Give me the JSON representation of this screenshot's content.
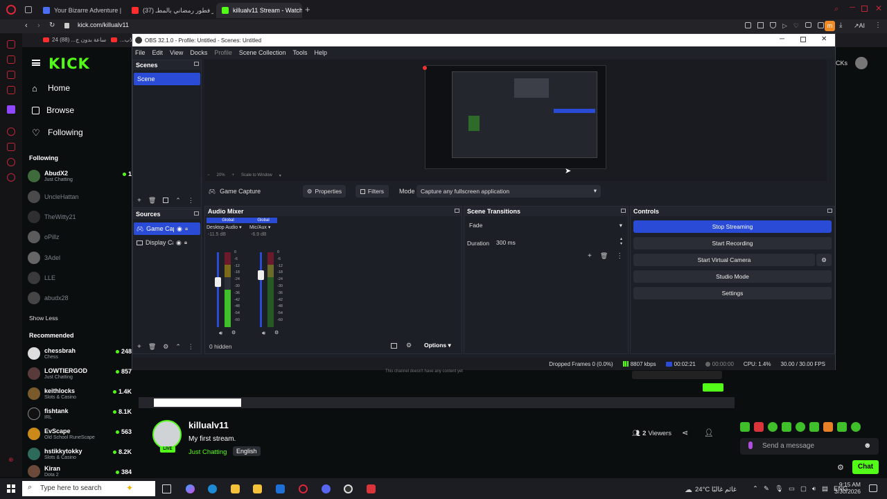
{
  "browser": {
    "tabs": [
      {
        "label": "Your Bizarre Adventure | P",
        "color": "#4c6ef5"
      },
      {
        "label": "افطر فطور رمضاني بالمطـ (37)",
        "color": "#ff2d2d"
      },
      {
        "label": "killualv11 Stream - Watch L",
        "color": "#53fc18"
      }
    ],
    "url": "kick.com/killualv11",
    "bookmarks": [
      "24 ساعة بدون ج... (88)",
      "...الكلاب"
    ],
    "profile_initial": "m",
    "ai_label": "AI"
  },
  "kick": {
    "logo": "KICK",
    "nav": [
      {
        "label": "Home",
        "icon": "home-icon"
      },
      {
        "label": "Browse",
        "icon": "browse-icon"
      },
      {
        "label": "Following",
        "icon": "heart-icon"
      }
    ],
    "following_header": "Following",
    "following": [
      {
        "name": "AbudX2",
        "category": "Just Chatting",
        "viewers": "1",
        "live": true
      },
      {
        "name": "UncleHattan",
        "category": "",
        "viewers": "",
        "live": false
      },
      {
        "name": "TheWitty21",
        "category": "",
        "viewers": "",
        "live": false
      },
      {
        "name": "oPillz",
        "category": "",
        "viewers": "",
        "live": false
      },
      {
        "name": "3Adel",
        "category": "",
        "viewers": "",
        "live": false
      },
      {
        "name": "LLE",
        "category": "",
        "viewers": "",
        "live": false
      },
      {
        "name": "abudx28",
        "category": "",
        "viewers": "",
        "live": false
      }
    ],
    "show_less": "Show Less",
    "recommended_header": "Recommended",
    "recommended": [
      {
        "name": "chessbrah",
        "category": "Chess",
        "viewers": "248"
      },
      {
        "name": "LOWTIERGOD",
        "category": "Just Chatting",
        "viewers": "857"
      },
      {
        "name": "keithlocks",
        "category": "Slots & Casino",
        "viewers": "1.4K"
      },
      {
        "name": "fishtank",
        "category": "IRL",
        "viewers": "8.1K"
      },
      {
        "name": "EvScape",
        "category": "Old School RuneScape",
        "viewers": "563"
      },
      {
        "name": "hstikkytokky",
        "category": "Slots & Casino",
        "viewers": "8.2K"
      },
      {
        "name": "Kiran",
        "category": "Dota 2",
        "viewers": "384"
      }
    ],
    "top_right_badge": "CKs"
  },
  "obs": {
    "title": "OBS 32.1.0 - Profile: Untitled - Scenes: Untitled",
    "menu": [
      "File",
      "Edit",
      "View",
      "Docks",
      "Profile",
      "Scene Collection",
      "Tools",
      "Help"
    ],
    "preview_zoom": "20%",
    "preview_scale": "Scale to Window",
    "source_toolbar": {
      "source_name": "Game Capture",
      "properties": "Properties",
      "filters": "Filters",
      "mode_label": "Mode",
      "mode_value": "Capture any fullscreen application"
    },
    "scenes": {
      "header": "Scenes",
      "items": [
        "Scene"
      ]
    },
    "sources": {
      "header": "Sources",
      "items": [
        "Game Capt",
        "Display Ca"
      ]
    },
    "audio_mixer": {
      "header": "Audio Mixer",
      "channels": [
        {
          "tag": "Global",
          "name": "Desktop Audio",
          "db": "-11.5 dB",
          "level": 0.55
        },
        {
          "tag": "Global",
          "name": "Mic/Aux",
          "db": "-6.9 dB",
          "level": 0.7
        }
      ],
      "scale": [
        "0",
        "-6",
        "-12",
        "-18",
        "-24",
        "-30",
        "-36",
        "-42",
        "-48",
        "-54",
        "-60"
      ],
      "hidden": "0 hidden",
      "options": "Options"
    },
    "transitions": {
      "header": "Scene Transitions",
      "value": "Fade",
      "duration_label": "Duration",
      "duration_value": "300 ms"
    },
    "controls": {
      "header": "Controls",
      "buttons": [
        "Stop Streaming",
        "Start Recording",
        "Start Virtual Camera",
        "Studio Mode",
        "Settings"
      ]
    },
    "status": {
      "dropped": "Dropped Frames 0 (0.0%)",
      "kbps": "8807 kbps",
      "live_time": "00:02:21",
      "rec_time": "00:00:00",
      "cpu": "CPU: 1.4%",
      "fps": "30.00 / 30.00 FPS"
    }
  },
  "stream": {
    "channel": "killualv11",
    "title": "My first stream.",
    "category": "Just Chatting",
    "language": "English",
    "live_badge": "LIVE",
    "viewers_count": "2",
    "viewers_label": "Viewers",
    "chat_placeholder": "Send a message",
    "chat_button": "Chat",
    "no_content": "This channel doesn't have any content yet"
  },
  "taskbar": {
    "search_placeholder": "Type here to search",
    "weather": "24°C  غائم غالبًا",
    "lang": "ENG",
    "time": "9:15 AM",
    "date": "3/30/2026"
  }
}
